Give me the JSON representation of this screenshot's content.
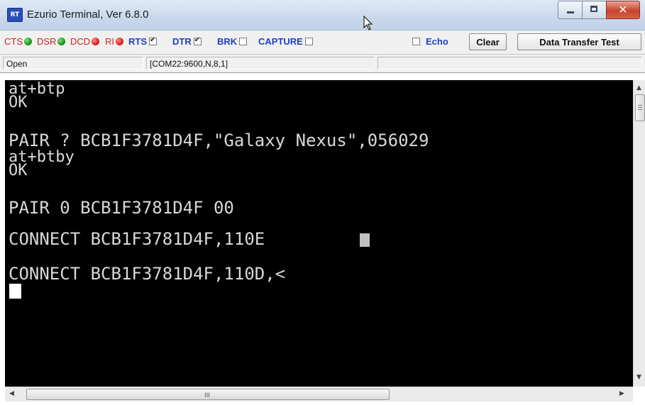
{
  "window": {
    "title": "Ezurio Terminal, Ver 6.8.0",
    "app_icon_text": "RT"
  },
  "toolbar": {
    "signals": [
      {
        "label": "CTS",
        "led": "green"
      },
      {
        "label": "DSR",
        "led": "green"
      },
      {
        "label": "DCD",
        "led": "red"
      },
      {
        "label": "RI",
        "led": "red"
      }
    ],
    "controls": [
      {
        "label": "RTS",
        "checked": true
      },
      {
        "label": "DTR",
        "checked": true
      },
      {
        "label": "BRK",
        "checked": false
      },
      {
        "label": "CAPTURE",
        "checked": false
      },
      {
        "label": "Echo",
        "checked": false
      }
    ],
    "clear_label": "Clear",
    "data_transfer_label": "Data Transfer Test"
  },
  "status": {
    "state": "Open",
    "port_settings": "[COM22:9600,N,8,1]"
  },
  "terminal": {
    "lines": [
      "at+btp",
      "OK",
      "PAIR ? BCB1F3781D4F,\"Galaxy Nexus\",056029",
      "at+btby",
      "OK",
      "PAIR 0 BCB1F3781D4F 00",
      "CONNECT BCB1F3781D4F,110E",
      "CONNECT BCB1F3781D4F,110D,<"
    ]
  },
  "hscroll": {
    "grip_text": "III"
  },
  "colors": {
    "signal_red": "#d02020",
    "control_blue": "#1f3fc8",
    "led_green": "#0a8a0a",
    "led_red": "#d41010",
    "terminal_bg": "#000000",
    "terminal_fg": "#d8d8d8"
  }
}
